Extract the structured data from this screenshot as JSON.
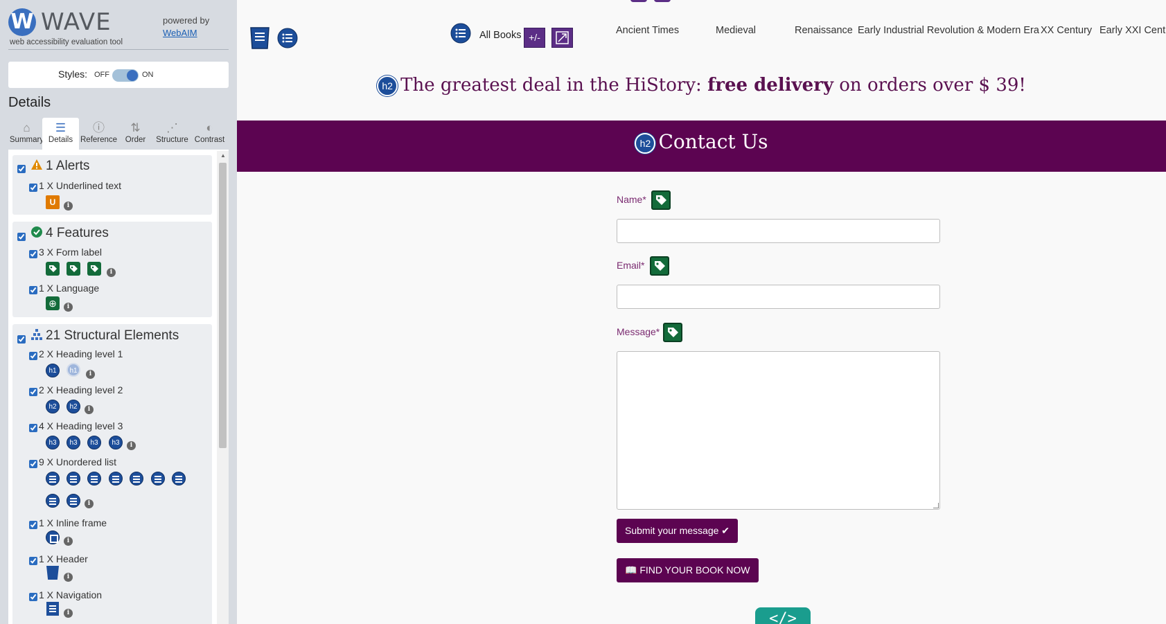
{
  "wave": {
    "logo_letter": "W",
    "logo_word": "WAVE",
    "tagline": "web accessibility evaluation tool",
    "powered_by": "powered by",
    "webaim_link": "WebAIM",
    "styles_label": "Styles:",
    "styles_off": "OFF",
    "styles_on": "ON",
    "details_title": "Details",
    "tabs": [
      {
        "label": "Summary",
        "icon": "home-icon",
        "glyph": "⌂"
      },
      {
        "label": "Details",
        "icon": "list-icon",
        "glyph": "☰"
      },
      {
        "label": "Reference",
        "icon": "info-icon",
        "glyph": "ⓘ"
      },
      {
        "label": "Order",
        "icon": "order-icon",
        "glyph": "⇅"
      },
      {
        "label": "Structure",
        "icon": "structure-icon",
        "glyph": "⋰"
      },
      {
        "label": "Contrast",
        "icon": "contrast-icon",
        "glyph": "◐"
      }
    ],
    "active_tab": "Details",
    "groups": {
      "alerts": {
        "title": "1 Alerts",
        "items": [
          {
            "label": "1 X Underlined text"
          }
        ],
        "alert_badge_text": "U"
      },
      "features": {
        "title": "4 Features",
        "items": [
          {
            "label": "3 X Form label"
          },
          {
            "label": "1 X Language"
          }
        ]
      },
      "structural": {
        "title": "21 Structural Elements",
        "items": [
          {
            "label": "2 X Heading level 1"
          },
          {
            "label": "2 X Heading level 2"
          },
          {
            "label": "4 X Heading level 3"
          },
          {
            "label": "9 X Unordered list"
          },
          {
            "label": "1 X Inline frame"
          },
          {
            "label": "1 X Header"
          },
          {
            "label": "1 X Navigation"
          }
        ],
        "h1": "h1",
        "h2": "h2",
        "h3": "h3"
      }
    },
    "info_glyph": "i"
  },
  "site": {
    "nav": {
      "all_books": "All Books",
      "plus_minus": "+/-",
      "links": [
        "Ancient Times",
        "Medieval",
        "Renaissance",
        "Early Industrial Revolution & Modern Era",
        "XX Century",
        "Early XXI Centu"
      ]
    },
    "promo": {
      "badge": "h2",
      "prefix": "The greatest deal in the HiStory: ",
      "bold": "free delivery",
      "suffix": " on orders over $ 39!"
    },
    "contact": {
      "badge": "h2",
      "title": "Contact Us",
      "name_label": "Name*",
      "email_label": "Email*",
      "message_label": "Message*",
      "submit": "Submit your message ✔",
      "find": "📖 FIND YOUR BOOK NOW"
    },
    "code_badge": "</>"
  },
  "colors": {
    "brand_purple": "#5c0451",
    "wave_blue": "#1d4e9a",
    "feature_green": "#136b3a",
    "alert_orange": "#e07a00"
  }
}
